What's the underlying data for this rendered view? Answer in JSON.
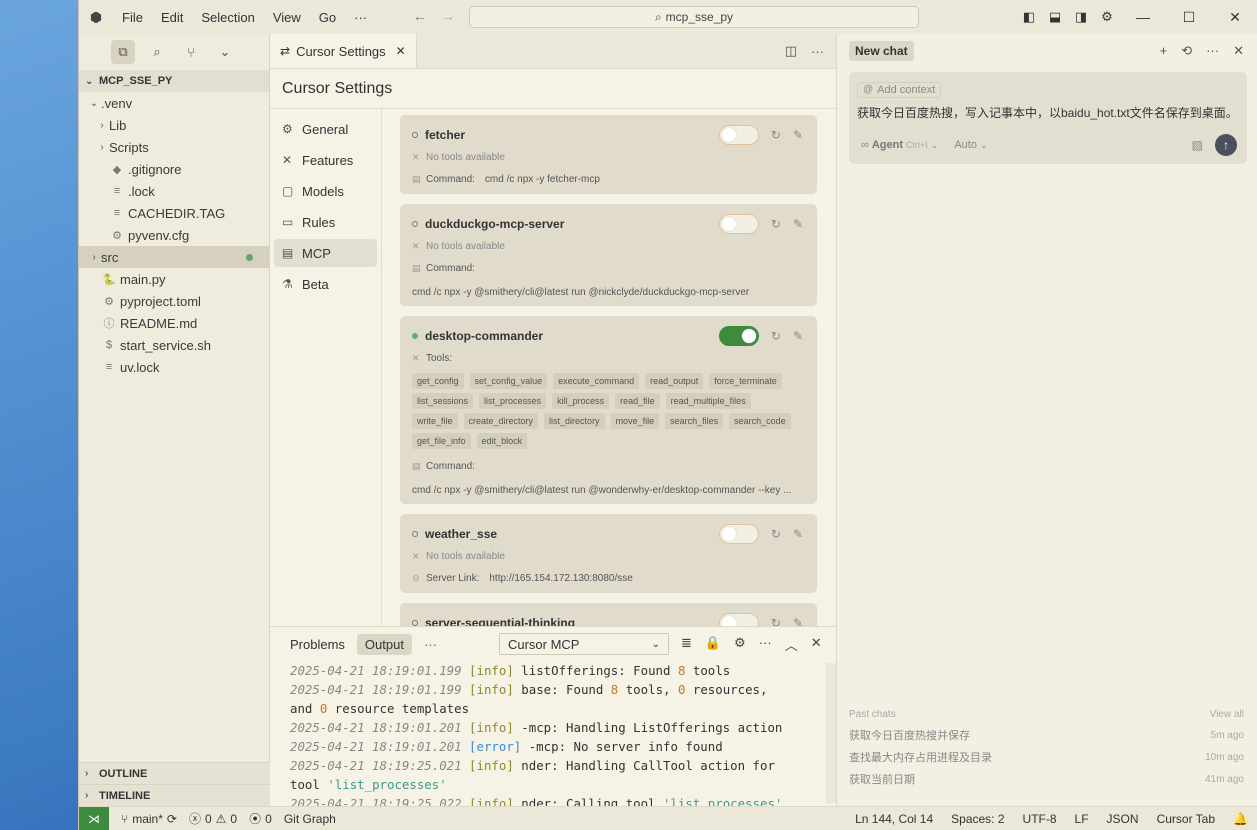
{
  "titlebar": {
    "menu": [
      "File",
      "Edit",
      "Selection",
      "View",
      "Go",
      "···"
    ],
    "search": "mcp_sse_py"
  },
  "explorer": {
    "project": "MCP_SSE_PY",
    "tree": [
      {
        "label": ".venv",
        "indent": 1,
        "chevron": "down",
        "icon": ""
      },
      {
        "label": "Lib",
        "indent": 2,
        "chevron": "right",
        "icon": ""
      },
      {
        "label": "Scripts",
        "indent": 2,
        "chevron": "right",
        "icon": ""
      },
      {
        "label": ".gitignore",
        "indent": 2,
        "chevron": "",
        "icon": "◆"
      },
      {
        "label": ".lock",
        "indent": 2,
        "chevron": "",
        "icon": "≡"
      },
      {
        "label": "CACHEDIR.TAG",
        "indent": 2,
        "chevron": "",
        "icon": "≡"
      },
      {
        "label": "pyvenv.cfg",
        "indent": 2,
        "chevron": "",
        "icon": "⚙"
      },
      {
        "label": "src",
        "indent": 1,
        "chevron": "right",
        "icon": "",
        "selected": true,
        "modified": true
      },
      {
        "label": "main.py",
        "indent": 1,
        "chevron": "",
        "icon": "🐍"
      },
      {
        "label": "pyproject.toml",
        "indent": 1,
        "chevron": "",
        "icon": "⚙"
      },
      {
        "label": "README.md",
        "indent": 1,
        "chevron": "",
        "icon": "ⓘ"
      },
      {
        "label": "start_service.sh",
        "indent": 1,
        "chevron": "",
        "icon": "$"
      },
      {
        "label": "uv.lock",
        "indent": 1,
        "chevron": "",
        "icon": "≡"
      }
    ],
    "outline": "OUTLINE",
    "timeline": "TIMELINE"
  },
  "editor": {
    "tab_label": "Cursor Settings",
    "settings_title": "Cursor Settings",
    "nav": [
      {
        "label": "General",
        "icon": "⚙"
      },
      {
        "label": "Features",
        "icon": "✕"
      },
      {
        "label": "Models",
        "icon": "▢"
      },
      {
        "label": "Rules",
        "icon": "▭"
      },
      {
        "label": "MCP",
        "icon": "▤",
        "active": true
      },
      {
        "label": "Beta",
        "icon": "⚗"
      }
    ],
    "servers": [
      {
        "name": "fetcher",
        "enabled": false,
        "status": "No tools available",
        "command_label": "Command:",
        "command": "cmd /c npx -y fetcher-mcp",
        "inline": true
      },
      {
        "name": "duckduckgo-mcp-server",
        "enabled": false,
        "status": "No tools available",
        "command_label": "Command:",
        "command": "cmd /c npx -y @smithery/cli@latest run @nickclyde/duckduckgo-mcp-server",
        "inline": false
      },
      {
        "name": "desktop-commander",
        "enabled": true,
        "status": "Tools:",
        "tools": [
          "get_config",
          "set_config_value",
          "execute_command",
          "read_output",
          "force_terminate",
          "list_sessions",
          "list_processes",
          "kill_process",
          "read_file",
          "read_multiple_files",
          "write_file",
          "create_directory",
          "list_directory",
          "move_file",
          "search_files",
          "search_code",
          "get_file_info",
          "edit_block"
        ],
        "command_label": "Command:",
        "command": "cmd /c npx -y @smithery/cli@latest run @wonderwhy-er/desktop-commander --key ...",
        "inline": false
      },
      {
        "name": "weather_sse",
        "enabled": false,
        "status": "No tools available",
        "command_label": "Server Link:",
        "command": "http://165.154.172.130:8080/sse",
        "inline": true
      },
      {
        "name": "server-sequential-thinking",
        "enabled": false,
        "status": "",
        "command_label": "",
        "command": "",
        "inline": true
      }
    ]
  },
  "panel": {
    "tabs": [
      "Problems",
      "Output"
    ],
    "active_tab": "Output",
    "more": "···",
    "channel": "Cursor MCP",
    "log": [
      [
        {
          "c": "ts",
          "t": "2025-04-21 18:19:01.199 "
        },
        {
          "c": "info",
          "t": "[info]"
        },
        {
          "c": "",
          "t": " listOfferings: Found "
        },
        {
          "c": "num",
          "t": "8"
        },
        {
          "c": "",
          "t": " tools"
        }
      ],
      [
        {
          "c": "ts",
          "t": "2025-04-21 18:19:01.199 "
        },
        {
          "c": "info",
          "t": "[info]"
        },
        {
          "c": "",
          "t": " base: Found "
        },
        {
          "c": "num",
          "t": "8"
        },
        {
          "c": "",
          "t": " tools, "
        },
        {
          "c": "num",
          "t": "0"
        },
        {
          "c": "",
          "t": " resources,"
        }
      ],
      [
        {
          "c": "",
          "t": "and "
        },
        {
          "c": "num",
          "t": "0"
        },
        {
          "c": "",
          "t": " resource templates"
        }
      ],
      [
        {
          "c": "ts",
          "t": "2025-04-21 18:19:01.201 "
        },
        {
          "c": "info",
          "t": "[info]"
        },
        {
          "c": "",
          "t": " -mcp: Handling ListOfferings action"
        }
      ],
      [
        {
          "c": "ts",
          "t": "2025-04-21 18:19:01.201 "
        },
        {
          "c": "err",
          "t": "[error]"
        },
        {
          "c": "",
          "t": " -mcp: No server info found"
        }
      ],
      [
        {
          "c": "ts",
          "t": "2025-04-21 18:19:25.021 "
        },
        {
          "c": "info",
          "t": "[info]"
        },
        {
          "c": "",
          "t": " nder: Handling CallTool action for"
        }
      ],
      [
        {
          "c": "",
          "t": "tool "
        },
        {
          "c": "str",
          "t": "'list_processes'"
        }
      ],
      [
        {
          "c": "ts",
          "t": "2025-04-21 18:19:25.022 "
        },
        {
          "c": "info",
          "t": "[info]"
        },
        {
          "c": "",
          "t": " nder: Calling tool "
        },
        {
          "c": "str",
          "t": "'list_processes'"
        }
      ]
    ]
  },
  "chat": {
    "new_chat": "New chat",
    "add_context": "Add context",
    "prompt": "获取今日百度热搜，写入记事本中，以baidu_hot.txt文件名保存到桌面。",
    "agent": "Agent",
    "agent_kbd": "Ctrl+I",
    "model": "Auto",
    "past_label": "Past chats",
    "view_all": "View all",
    "past": [
      {
        "title": "获取今日百度热搜并保存",
        "time": "5m ago"
      },
      {
        "title": "查找最大内存占用进程及目录",
        "time": "10m ago"
      },
      {
        "title": "获取当前日期",
        "time": "41m ago"
      }
    ]
  },
  "status": {
    "branch": "main*",
    "errors": "0",
    "warnings": "0",
    "ports": "0",
    "git_graph": "Git Graph",
    "position": "Ln 144, Col 14",
    "spaces": "Spaces: 2",
    "encoding": "UTF-8",
    "eol": "LF",
    "language": "JSON",
    "tab": "Cursor Tab"
  },
  "colors": {
    "accent_green": "#3d8b3d",
    "status_dot": "#5ab36a",
    "bg": "#f3efe2"
  }
}
